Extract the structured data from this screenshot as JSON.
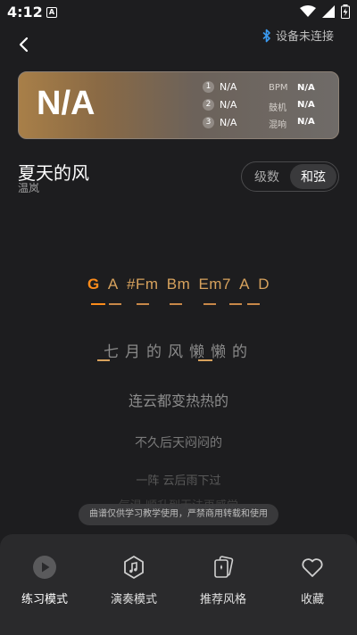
{
  "status_bar": {
    "time": "4:12",
    "notification_glyph": "A"
  },
  "header": {
    "bluetooth_label": "设备未连接"
  },
  "key_card": {
    "key": "N/A",
    "slots": [
      {
        "num": "1",
        "value": "N/A"
      },
      {
        "num": "2",
        "value": "N/A"
      },
      {
        "num": "3",
        "value": "N/A"
      }
    ],
    "params": [
      {
        "label": "BPM",
        "value": "N/A"
      },
      {
        "label": "鼓机",
        "value": "N/A"
      },
      {
        "label": "混响",
        "value": "N/A"
      }
    ]
  },
  "song": {
    "title": "夏天的风",
    "artist": "温岚"
  },
  "mode_toggle": {
    "options": [
      "级数",
      "和弦"
    ],
    "selected": "和弦"
  },
  "chords": [
    "G",
    "A",
    "#Fm",
    "Bm",
    "Em7",
    "A",
    "D"
  ],
  "current_chord_index": 0,
  "lyrics": {
    "current": "七月的风懒懒的",
    "next": [
      "连云都变热热的",
      "不久后天闷闷的",
      "一阵 云后雨下过",
      "气温 顺升到无法再感觉"
    ]
  },
  "notice": "曲谱仅供学习教学使用，严禁商用转载和使用",
  "nav": {
    "items": [
      {
        "label": "练习模式",
        "icon": "play-circle-icon"
      },
      {
        "label": "演奏模式",
        "icon": "music-note-icon"
      },
      {
        "label": "推荐风格",
        "icon": "recommend-cards-icon"
      },
      {
        "label": "收藏",
        "icon": "heart-icon"
      }
    ],
    "active_index": 0
  },
  "colors": {
    "accent": "#ff8c1a",
    "chord": "#d7a25d",
    "background": "#1d1d1f"
  }
}
